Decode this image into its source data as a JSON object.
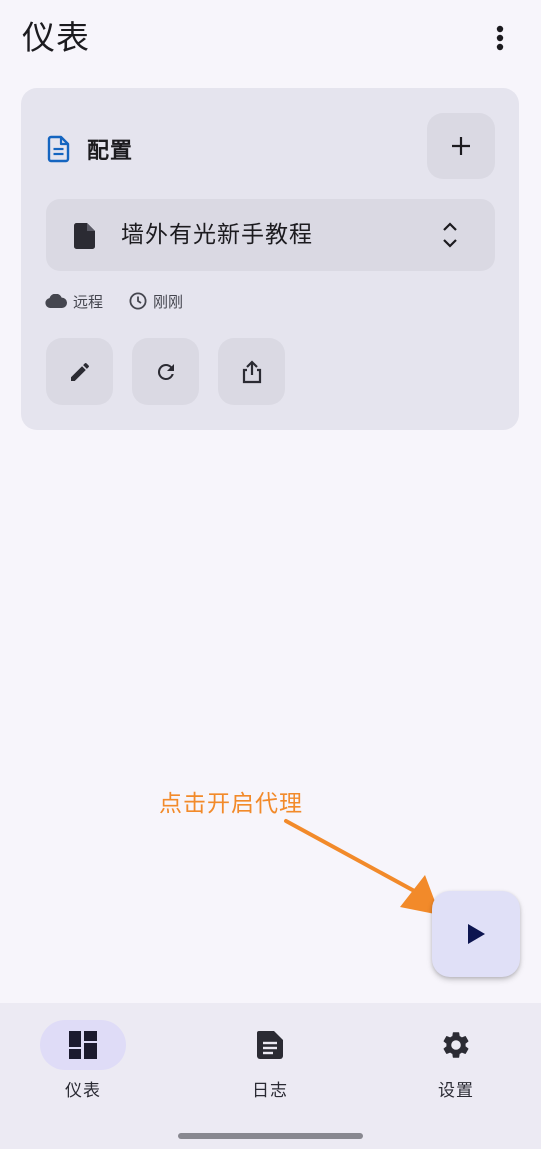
{
  "app": {
    "title": "仪表"
  },
  "card": {
    "header_label": "配置",
    "profile_name": "墙外有光新手教程",
    "meta": {
      "type": "远程",
      "updated": "刚刚"
    }
  },
  "hint": {
    "text": "点击开启代理"
  },
  "colors": {
    "accent": "#1565c0",
    "hint": "#f28a2a",
    "fab_icon": "#0d1550"
  },
  "nav": {
    "items": [
      {
        "label": "仪表",
        "icon": "dashboard-icon"
      },
      {
        "label": "日志",
        "icon": "article-icon"
      },
      {
        "label": "设置",
        "icon": "gear-icon"
      }
    ]
  }
}
